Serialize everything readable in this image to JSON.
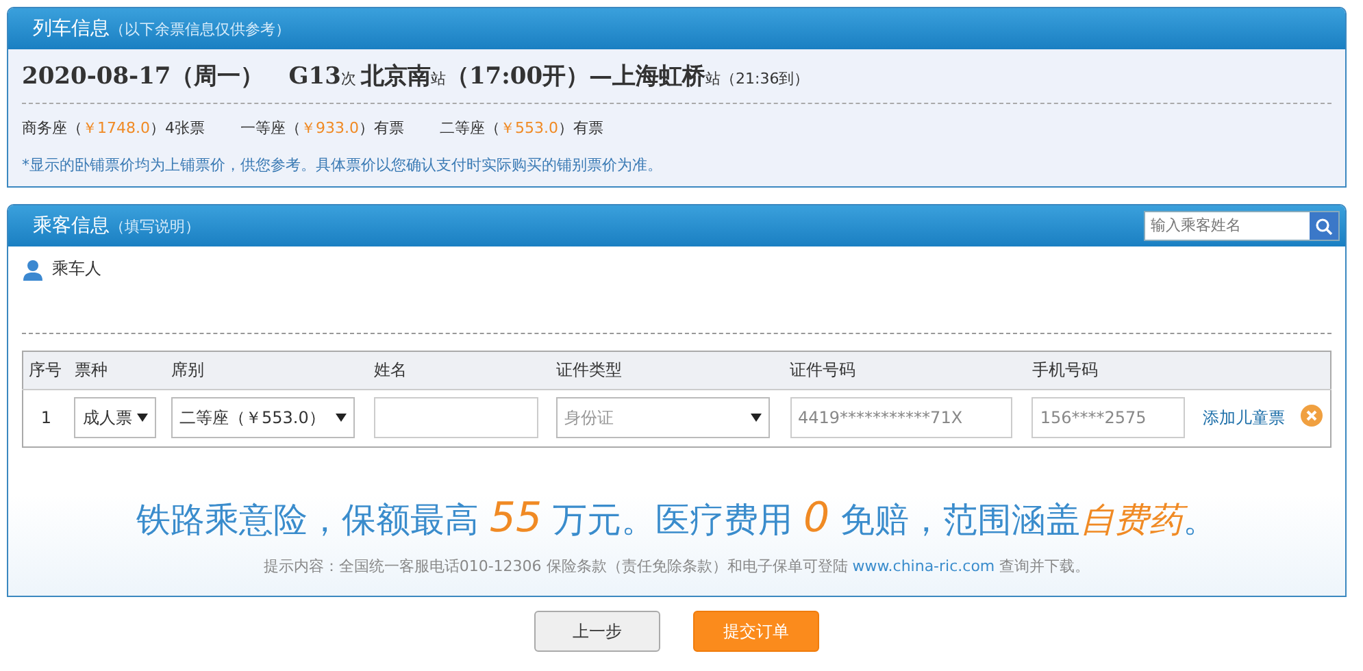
{
  "train_panel": {
    "title": "列车信息",
    "subtitle": "（以下余票信息仅供参考）",
    "route": [
      {
        "kind": "big",
        "text": "2020-08-17（周一）"
      },
      {
        "kind": "gap"
      },
      {
        "kind": "big",
        "text": "G13"
      },
      {
        "kind": "small",
        "text": "次 "
      },
      {
        "kind": "big",
        "text": "北京南"
      },
      {
        "kind": "small",
        "text": "站"
      },
      {
        "kind": "big",
        "text": "（17:00开）—上海虹桥"
      },
      {
        "kind": "small",
        "text": "站（21:36到）"
      }
    ],
    "seats": [
      {
        "name": "商务座（",
        "price": "￥1748.0",
        "rest": "）4张票"
      },
      {
        "name": "一等座（",
        "price": "￥933.0",
        "rest": "）有票"
      },
      {
        "name": "二等座（",
        "price": "￥553.0",
        "rest": "）有票"
      }
    ],
    "note": "*显示的卧铺票价均为上铺票价，供您参考。具体票价以您确认支付时实际购买的铺别票价为准。"
  },
  "passenger_panel": {
    "title": "乘客信息",
    "subtitle": "（填写说明）",
    "search": {
      "placeholder": "输入乘客姓名"
    },
    "passengers_label": "乘车人",
    "table": {
      "columns": [
        "序号",
        "票种",
        "席别",
        "姓名",
        "证件类型",
        "证件号码",
        "手机号码"
      ],
      "rows": [
        {
          "index": "1",
          "ticket_type": "成人票",
          "seat": "二等座（￥553.0）",
          "id_type": "身份证",
          "id_number": "4419***********71X",
          "phone": "156****2575",
          "add_child": "添加儿童票"
        }
      ]
    }
  },
  "insurance": {
    "parts": [
      {
        "kind": "blue",
        "text": "铁路乘意险，保额最高 "
      },
      {
        "kind": "orange",
        "text": "55"
      },
      {
        "kind": "blue",
        "text": " 万元。医疗费用 "
      },
      {
        "kind": "orange",
        "text": "0"
      },
      {
        "kind": "blue",
        "text": " 免赔，范围涵盖"
      },
      {
        "kind": "orange",
        "text": "自费药"
      },
      {
        "kind": "blue",
        "text": "。"
      }
    ],
    "hint": "提示内容：全国统一客服电话010-12306 保险条款（责任免除条款）和电子保单可登陆",
    "link": "www.china-ric.com",
    "hint_end": "查询并下载。"
  },
  "buttons": [
    {
      "kind": "secondary",
      "label": "上一步"
    },
    {
      "kind": "primary",
      "label": "提交订单"
    }
  ]
}
